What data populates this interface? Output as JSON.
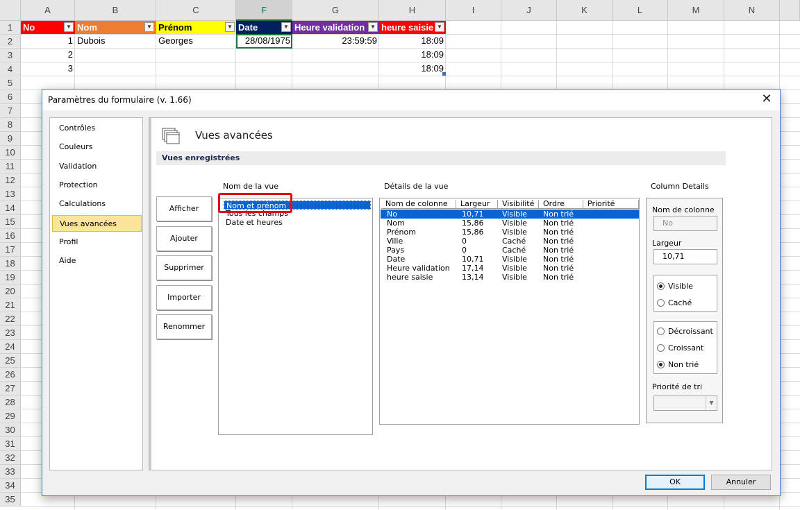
{
  "sheet": {
    "columns": [
      "A",
      "B",
      "C",
      "F",
      "G",
      "H",
      "I",
      "J",
      "K",
      "L",
      "M",
      "N"
    ],
    "selected_column": "F",
    "rows": [
      "1",
      "2",
      "3",
      "4",
      "5",
      "6",
      "7",
      "8",
      "9",
      "10",
      "11",
      "12",
      "13",
      "14",
      "15",
      "16",
      "17",
      "18",
      "19",
      "20",
      "21",
      "22",
      "23",
      "24",
      "25",
      "26",
      "27",
      "28",
      "29",
      "30",
      "31",
      "32",
      "33",
      "34",
      "35"
    ],
    "headers": [
      {
        "label": "No",
        "bg": "#ff0000",
        "fg": "#ffffff"
      },
      {
        "label": "Nom",
        "bg": "#ed7d31",
        "fg": "#ffffff"
      },
      {
        "label": "Prénom",
        "bg": "#ffff00",
        "fg": "#000000"
      },
      {
        "label": "Date",
        "bg": "#002060",
        "fg": "#ffffff"
      },
      {
        "label": "Heure validation",
        "bg": "#7030a0",
        "fg": "#ffffff"
      },
      {
        "label": "heure saisie",
        "bg": "#ff0000",
        "fg": "#ffffff"
      }
    ],
    "data_rows": [
      {
        "no": "1",
        "nom": "Dubois",
        "prenom": "Georges",
        "date": "28/08/1975",
        "heure_validation": "23:59:59",
        "heure_saisie": "18:09"
      },
      {
        "no": "2",
        "nom": "",
        "prenom": "",
        "date": "",
        "heure_validation": "",
        "heure_saisie": "18:09"
      },
      {
        "no": "3",
        "nom": "",
        "prenom": "",
        "date": "",
        "heure_validation": "",
        "heure_saisie": "18:09"
      }
    ]
  },
  "dialog": {
    "title": "Paramètres du formulaire (v. 1.66)",
    "nav": [
      "Contrôles",
      "Couleurs",
      "Validation",
      "Protection",
      "Calculations",
      "Vues avancées",
      "Profil",
      "Aide"
    ],
    "active_nav": "Vues avancées",
    "panel_title": "Vues avancées",
    "section_title": "Vues enregistrées",
    "buttons": [
      "Afficher",
      "Ajouter",
      "Supprimer",
      "Importer",
      "Renommer"
    ],
    "view_name_label": "Nom de la vue",
    "views": [
      "Nom et prénom",
      "Tous les champs",
      "Date et heures"
    ],
    "details_label": "Détails de la vue",
    "table_headers": [
      "Nom de colonne",
      "Largeur",
      "Visibilité",
      "Ordre",
      "Priorité"
    ],
    "table_rows": [
      {
        "name": "No",
        "width": "10,71",
        "visibility": "Visible",
        "order": "Non trié",
        "priority": ""
      },
      {
        "name": "Nom",
        "width": "15,86",
        "visibility": "Visible",
        "order": "Non trié",
        "priority": ""
      },
      {
        "name": "Prénom",
        "width": "15,86",
        "visibility": "Visible",
        "order": "Non trié",
        "priority": ""
      },
      {
        "name": "Ville",
        "width": "0",
        "visibility": "Caché",
        "order": "Non trié",
        "priority": ""
      },
      {
        "name": "Pays",
        "width": "0",
        "visibility": "Caché",
        "order": "Non trié",
        "priority": ""
      },
      {
        "name": "Date",
        "width": "10,71",
        "visibility": "Visible",
        "order": "Non trié",
        "priority": ""
      },
      {
        "name": "Heure validation",
        "width": "17,14",
        "visibility": "Visible",
        "order": "Non trié",
        "priority": ""
      },
      {
        "name": "heure saisie",
        "width": "13,14",
        "visibility": "Visible",
        "order": "Non trié",
        "priority": ""
      }
    ],
    "column_details": {
      "title": "Column Details",
      "name_label": "Nom de colonne",
      "name_value": "No",
      "width_label": "Largeur",
      "width_value": "10,71",
      "visibility_options": [
        "Visible",
        "Caché"
      ],
      "visibility_selected": "Visible",
      "order_options": [
        "Décroissant",
        "Croissant",
        "Non trié"
      ],
      "order_selected": "Non trié",
      "priority_label": "Priorité de tri",
      "priority_value": ""
    },
    "ok": "OK",
    "cancel": "Annuler"
  }
}
